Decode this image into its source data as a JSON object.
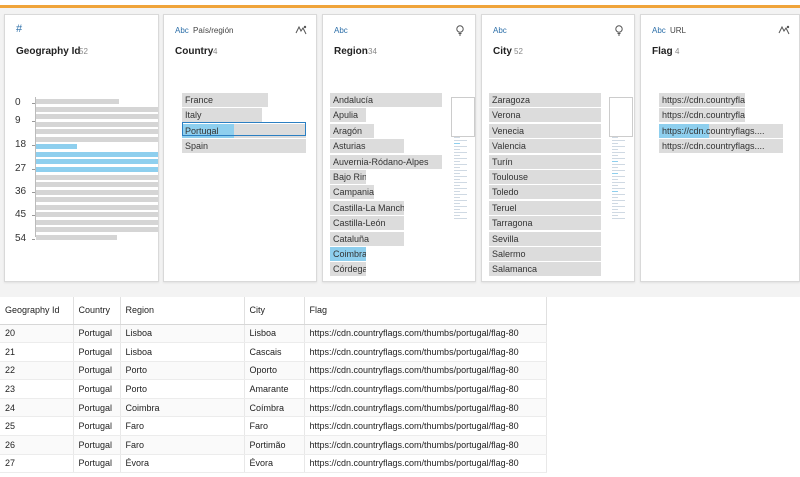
{
  "profiles": {
    "geography_id": {
      "type_icon": "#",
      "title": "Geography Id",
      "count": "52",
      "axis_labels": [
        "0",
        "9",
        "18",
        "27",
        "36",
        "45",
        "54"
      ],
      "bar_levels": [
        0.68,
        1,
        1,
        1,
        1,
        1,
        0.34,
        1,
        1,
        1,
        1,
        1,
        1,
        1,
        1,
        1,
        1,
        1,
        0.66
      ],
      "selected_bars": [
        6,
        7,
        8,
        9
      ]
    },
    "country": {
      "type_icon": "Abc",
      "subtitle": "País/región",
      "title": "Country",
      "count": "4",
      "items": [
        "France",
        "Italy",
        "Portugal",
        "Spain"
      ],
      "selected": "Portugal"
    },
    "region": {
      "type_icon": "Abc",
      "title": "Region",
      "count": "34",
      "items": [
        "Andalucía",
        "Apulia",
        "Aragón",
        "Asturias",
        "Auvernia-Ródano-Alpes",
        "Bajo Rin",
        "Campania",
        "Castilla-La Mancha",
        "Castilla-León",
        "Cataluña",
        "Coimbra",
        "Córdega"
      ],
      "selected": "Coimbra"
    },
    "city": {
      "type_icon": "Abc",
      "title": "City",
      "count": "52",
      "items": [
        "Zaragoza",
        "Verona",
        "Venecia",
        "Valencia",
        "Turín",
        "Toulouse",
        "Toledo",
        "Teruel",
        "Tarragona",
        "Sevilla",
        "Salermo",
        "Salamanca"
      ]
    },
    "flag": {
      "type_icon": "Abc",
      "subtitle": "URL",
      "title": "Flag",
      "count": "4",
      "items": [
        "https://cdn.countryflags....",
        "https://cdn.countryflags....",
        "https://cdn.countryflags....",
        "https://cdn.countryflags...."
      ],
      "selected_index": 2
    }
  },
  "table": {
    "headers": [
      "Geography Id",
      "Country",
      "Region",
      "City",
      "Flag"
    ],
    "rows": [
      [
        "20",
        "Portugal",
        "Lisboa",
        "Lisboa",
        "https://cdn.countryflags.com/thumbs/portugal/flag-80"
      ],
      [
        "21",
        "Portugal",
        "Lisboa",
        "Cascais",
        "https://cdn.countryflags.com/thumbs/portugal/flag-80"
      ],
      [
        "22",
        "Portugal",
        "Porto",
        "Oporto",
        "https://cdn.countryflags.com/thumbs/portugal/flag-80"
      ],
      [
        "23",
        "Portugal",
        "Porto",
        "Amarante",
        "https://cdn.countryflags.com/thumbs/portugal/flag-80"
      ],
      [
        "24",
        "Portugal",
        "Coimbra",
        "Coímbra",
        "https://cdn.countryflags.com/thumbs/portugal/flag-80"
      ],
      [
        "25",
        "Portugal",
        "Faro",
        "Faro",
        "https://cdn.countryflags.com/thumbs/portugal/flag-80"
      ],
      [
        "26",
        "Portugal",
        "Faro",
        "Portimão",
        "https://cdn.countryflags.com/thumbs/portugal/flag-80"
      ],
      [
        "27",
        "Portugal",
        "Évora",
        "Évora",
        "https://cdn.countryflags.com/thumbs/portugal/flag-80"
      ]
    ]
  },
  "colors": {
    "accent_bar": "#f0a43a",
    "selection": "#8ecfee",
    "selection_border": "#2b7fc2",
    "type_icon": "#2b6ea8"
  }
}
